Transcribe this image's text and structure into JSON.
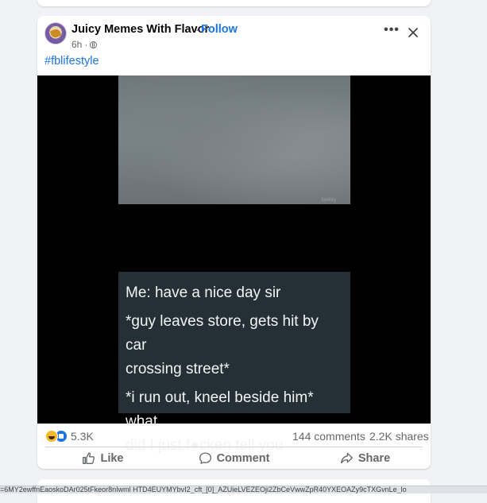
{
  "post": {
    "page_name": "Juicy Memes With Flavor",
    "separator": "·",
    "follow_label": "Follow",
    "time": "6h",
    "time_separator": "·",
    "more_label": "•••",
    "hashtag": "#fblifestyle"
  },
  "media": {
    "watermark": "lowkey",
    "text_lines": [
      "Me: have a nice day sir",
      "*guy leaves store, gets hit by car",
      "crossing street*",
      "*i run out, kneel beside him* what",
      "did I just f●cken tell you"
    ]
  },
  "stats": {
    "reaction_count": "5.3K",
    "comments": "144 comments",
    "shares": "2.2K shares"
  },
  "actions": {
    "like": "Like",
    "comment": "Comment",
    "share": "Share"
  },
  "status_url": "=6MY2ewffnEaoskoDAr025tFkeor8nIwml HTD4EUYMYbvI2_cft_[0]_AZUieLVEZEOji2ZbCeVwwZpR40YXEOAZy9cTXGvnLe_lo",
  "colors": {
    "accent": "#1b74e4",
    "secondary_text": "#65676b",
    "background": "#f0f2f5",
    "meme_box": "#253036"
  },
  "icons": {
    "more": "more-dots-icon",
    "close": "close-icon",
    "privacy": "globe-icon",
    "like": "thumbs-up-icon",
    "comment": "comment-bubble-icon",
    "share": "share-arrow-icon"
  }
}
